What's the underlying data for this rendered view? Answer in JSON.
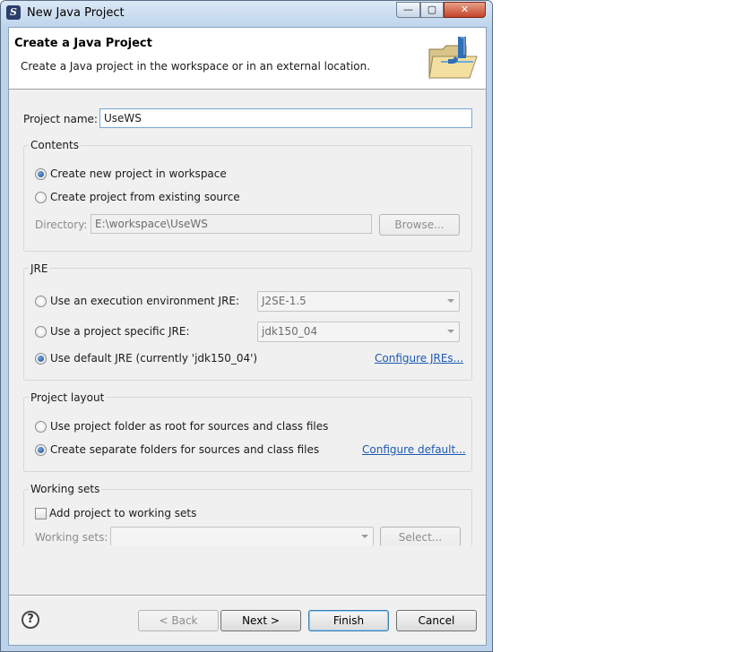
{
  "window": {
    "title": "New Java Project",
    "close_glyph": "✕",
    "min_glyph": "—",
    "max_glyph": "▢"
  },
  "header": {
    "title": "Create a Java Project",
    "description": "Create a Java project in the workspace or in an external location.",
    "icon": "java-project-folder-icon"
  },
  "project_name": {
    "label": "Project name:",
    "value": "UseWS"
  },
  "contents": {
    "title": "Contents",
    "option_new": "Create new project in workspace",
    "option_existing": "Create project from existing source",
    "selected": "option_new",
    "directory_label": "Directory:",
    "directory_value": "E:\\workspace\\UseWS",
    "browse_label": "Browse..."
  },
  "jre": {
    "title": "JRE",
    "option_env": "Use an execution environment JRE:",
    "env_value": "J2SE-1.5",
    "option_specific": "Use a project specific JRE:",
    "specific_value": "jdk150_04",
    "option_default": "Use default JRE (currently 'jdk150_04')",
    "selected": "option_default",
    "configure_link": "Configure JREs..."
  },
  "layout": {
    "title": "Project layout",
    "option_root": "Use project folder as root for sources and class files",
    "option_separate": "Create separate folders for sources and class files",
    "selected": "option_separate",
    "configure_link": "Configure default..."
  },
  "working_sets": {
    "title": "Working sets",
    "add_label": "Add project to working sets",
    "add_checked": false,
    "sets_label": "Working sets:",
    "sets_value": "",
    "select_label": "Select..."
  },
  "footer": {
    "help_glyph": "?",
    "back_label": "< Back",
    "next_label": "Next >",
    "finish_label": "Finish",
    "cancel_label": "Cancel"
  }
}
